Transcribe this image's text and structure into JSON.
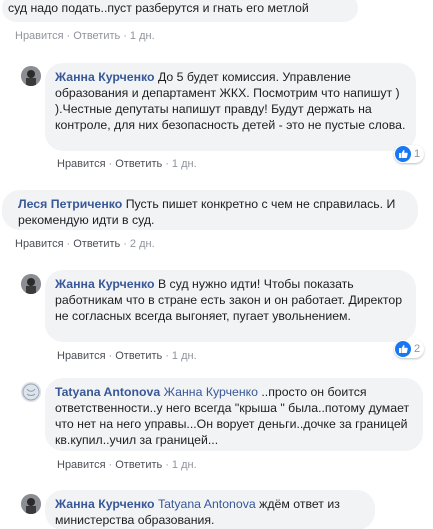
{
  "labels": {
    "like": "Нравится",
    "reply": "Ответить",
    "sep": "·"
  },
  "comments": [
    {
      "text": "суд надо подать..пуст разберутся и гнать его метлой",
      "time": "1 дн."
    },
    {
      "author": "Жанна Курченко",
      "text": "До 5 будет комиссия. Управление образования и департамент ЖКХ. Посмотрим что напишут ) ).Честные депутаты напишут правду! Будут держать на контроле, для них безопасность детей - это не пустые слова.",
      "time": "1 дн.",
      "reactions": "1"
    },
    {
      "author": "Леся Петриченко",
      "text": "Пусть пишет конкретно с чем не справилась. И рекомендую идти в суд.",
      "time": "2 дн."
    },
    {
      "author": "Жанна Курченко",
      "text": "В суд нужно идти! Чтобы показать работникам что в стране есть закон и он работает. Директор не согласных всегда выгоняет, пугает увольнением.",
      "time": "1 дн.",
      "reactions": "2"
    },
    {
      "author": "Tatyana Antonova",
      "mention": "Жанна Курченко",
      "text": "..просто он боится ответственности..у него всегда \"крыша \" была..потому думает что нет на него управы...Он ворует деньги..дочке за границей кв.купил..учил за границей...",
      "time": "1 дн."
    },
    {
      "author": "Жанна Курченко",
      "mention": "Tatyana Antonova",
      "text": "ждём ответ из министерства образования."
    }
  ],
  "colors": {
    "link": "#385898",
    "bubble": "#f2f3f5",
    "meta": "#90949c",
    "like_blue": "#1877f2"
  }
}
